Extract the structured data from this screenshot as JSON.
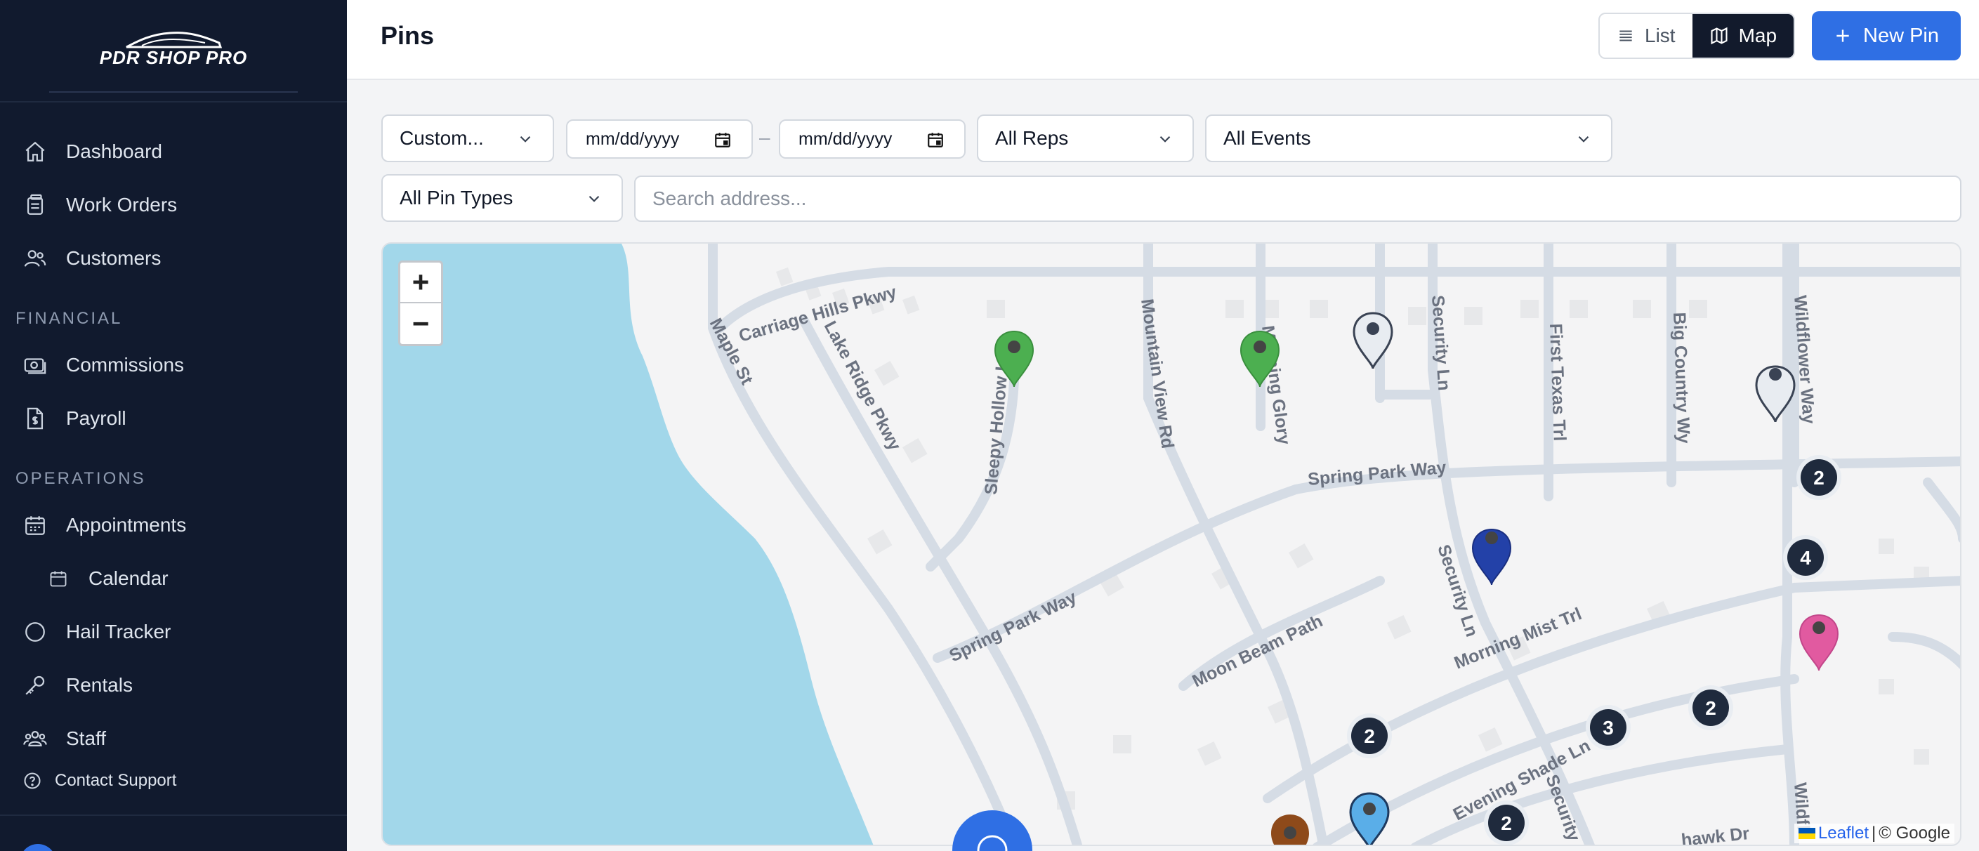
{
  "brand": {
    "name": "PDR SHOP PRO"
  },
  "sidebar": {
    "nav": [
      {
        "label": "Dashboard",
        "icon": "home-icon"
      },
      {
        "label": "Work Orders",
        "icon": "clipboard-icon"
      },
      {
        "label": "Customers",
        "icon": "users-icon"
      }
    ],
    "financial_heading": "FINANCIAL",
    "financial": [
      {
        "label": "Commissions",
        "icon": "money-icon"
      },
      {
        "label": "Payroll",
        "icon": "document-dollar-icon"
      }
    ],
    "operations_heading": "OPERATIONS",
    "operations": [
      {
        "label": "Appointments",
        "icon": "calendar-grid-icon"
      },
      {
        "label": "Calendar",
        "icon": "calendar-icon"
      },
      {
        "label": "Hail Tracker",
        "icon": "circle-icon"
      },
      {
        "label": "Rentals",
        "icon": "key-icon"
      },
      {
        "label": "Staff",
        "icon": "team-icon"
      }
    ],
    "support_label": "Contact Support"
  },
  "header": {
    "title": "Pins",
    "list_label": "List",
    "map_label": "Map",
    "active_view": "Map",
    "new_pin_label": "New Pin"
  },
  "filters": {
    "date_range": "Custom...",
    "start_date_placeholder": "mm/dd/yyyy",
    "date_separator": "–",
    "end_date_placeholder": "mm/dd/yyyy",
    "reps": "All Reps",
    "events": "All Events",
    "pin_types": "All Pin Types",
    "search_placeholder": "Search address..."
  },
  "map": {
    "zoom_in": "+",
    "zoom_out": "−",
    "streets": [
      "Carriage Hills Pkwy",
      "Maple St",
      "Lake Ridge Pkwy",
      "Sleepy Hollow Ln",
      "Mountain View Rd",
      "Morning Glory",
      "Security Ln",
      "First Texas Trl",
      "Big Country Wy",
      "Wildflower Way",
      "Spring Park Way",
      "Spring Park Way",
      "Moon Beam Path",
      "Morning Mist Trl",
      "Security Ln",
      "Evening Shade Ln",
      "Security",
      "Wildfl",
      "hawk Dr"
    ],
    "clusters": [
      "2",
      "4",
      "2",
      "3",
      "2",
      "2"
    ],
    "pin_colors": {
      "green": "#4caf50",
      "gray": "#e8ecf1",
      "navy": "#2341a8",
      "pink": "#e15aa0",
      "lightblue": "#5aaee8",
      "brown": "#8e4a1a"
    },
    "attribution_link": "Leaflet",
    "attribution_sep": "|",
    "attribution_text": "© Google"
  }
}
